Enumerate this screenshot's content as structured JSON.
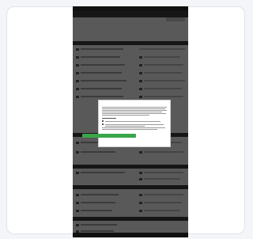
{
  "colors": {
    "page_background": "#f4f5f8",
    "card_border": "#dfe3ea",
    "agree_button": "#3aa64a",
    "dark_bar": "#2c2c2c"
  },
  "icons": [
    "back-icon",
    "menu-icon",
    "checkbox-icon"
  ],
  "modal": {
    "title": "",
    "agree_label": "",
    "cancel_label": ""
  }
}
